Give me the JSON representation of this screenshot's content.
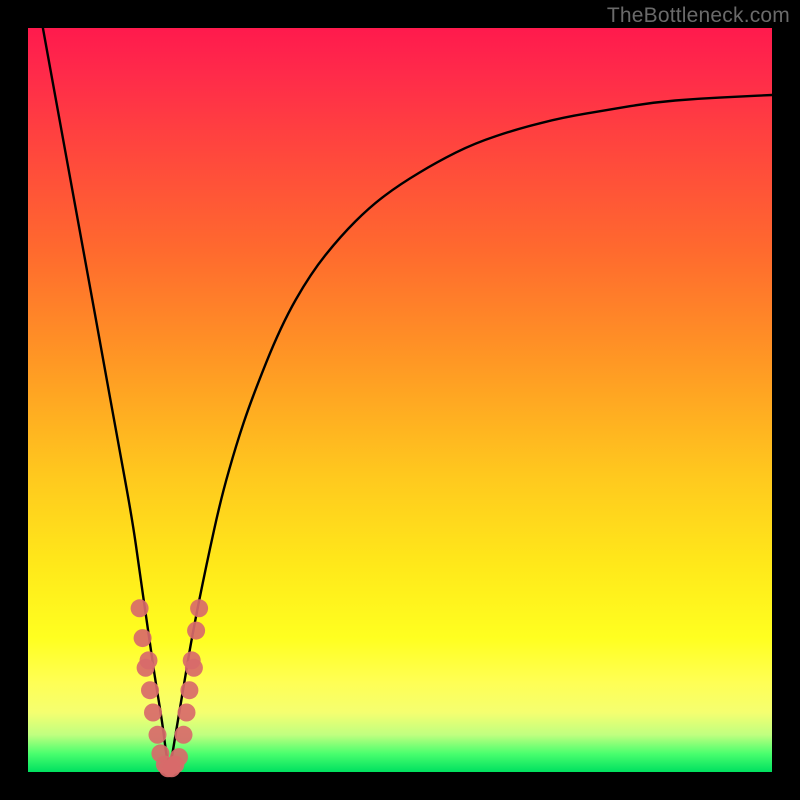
{
  "watermark": "TheBottleneck.com",
  "chart_data": {
    "type": "line",
    "title": "",
    "xlabel": "",
    "ylabel": "",
    "xlim": [
      0,
      100
    ],
    "ylim": [
      0,
      100
    ],
    "series": [
      {
        "name": "bottleneck-curve",
        "x": [
          2,
          4,
          6,
          8,
          10,
          12,
          14,
          15,
          16,
          17,
          18,
          18.5,
          19,
          19.5,
          20,
          21,
          22,
          24,
          26,
          28,
          30,
          34,
          38,
          42,
          46,
          50,
          55,
          60,
          66,
          72,
          78,
          84,
          90,
          96,
          100
        ],
        "y": [
          100,
          89,
          78,
          67,
          56,
          45,
          34,
          27,
          20,
          13,
          7,
          3,
          0,
          3,
          6,
          12,
          18,
          28,
          37,
          44,
          50,
          60,
          67,
          72,
          76,
          79,
          82,
          84.5,
          86.5,
          88,
          89,
          90,
          90.5,
          90.8,
          91
        ],
        "note": "y=0 is the green zone at the bottom; y=100 is the top (red). Minimum (optimal point) is near x≈19."
      }
    ],
    "markers": {
      "name": "sample-points",
      "color": "#d86a6a",
      "note": "salmon dots clustered near the curve minimum",
      "points": [
        {
          "x": 15.0,
          "y": 22
        },
        {
          "x": 15.4,
          "y": 18
        },
        {
          "x": 15.8,
          "y": 14
        },
        {
          "x": 16.2,
          "y": 15
        },
        {
          "x": 16.4,
          "y": 11
        },
        {
          "x": 16.8,
          "y": 8
        },
        {
          "x": 17.4,
          "y": 5
        },
        {
          "x": 17.8,
          "y": 2.5
        },
        {
          "x": 18.4,
          "y": 1.0
        },
        {
          "x": 18.8,
          "y": 0.5
        },
        {
          "x": 19.3,
          "y": 0.5
        },
        {
          "x": 19.8,
          "y": 1.0
        },
        {
          "x": 20.3,
          "y": 2.0
        },
        {
          "x": 20.9,
          "y": 5
        },
        {
          "x": 21.3,
          "y": 8
        },
        {
          "x": 21.7,
          "y": 11
        },
        {
          "x": 22.0,
          "y": 15
        },
        {
          "x": 22.3,
          "y": 14
        },
        {
          "x": 22.6,
          "y": 19
        },
        {
          "x": 23.0,
          "y": 22
        }
      ]
    },
    "gradient_stops": [
      {
        "pos": 0,
        "color": "#ff1a4d"
      },
      {
        "pos": 50,
        "color": "#ffb020"
      },
      {
        "pos": 85,
        "color": "#ffff30"
      },
      {
        "pos": 100,
        "color": "#00e060"
      }
    ]
  }
}
